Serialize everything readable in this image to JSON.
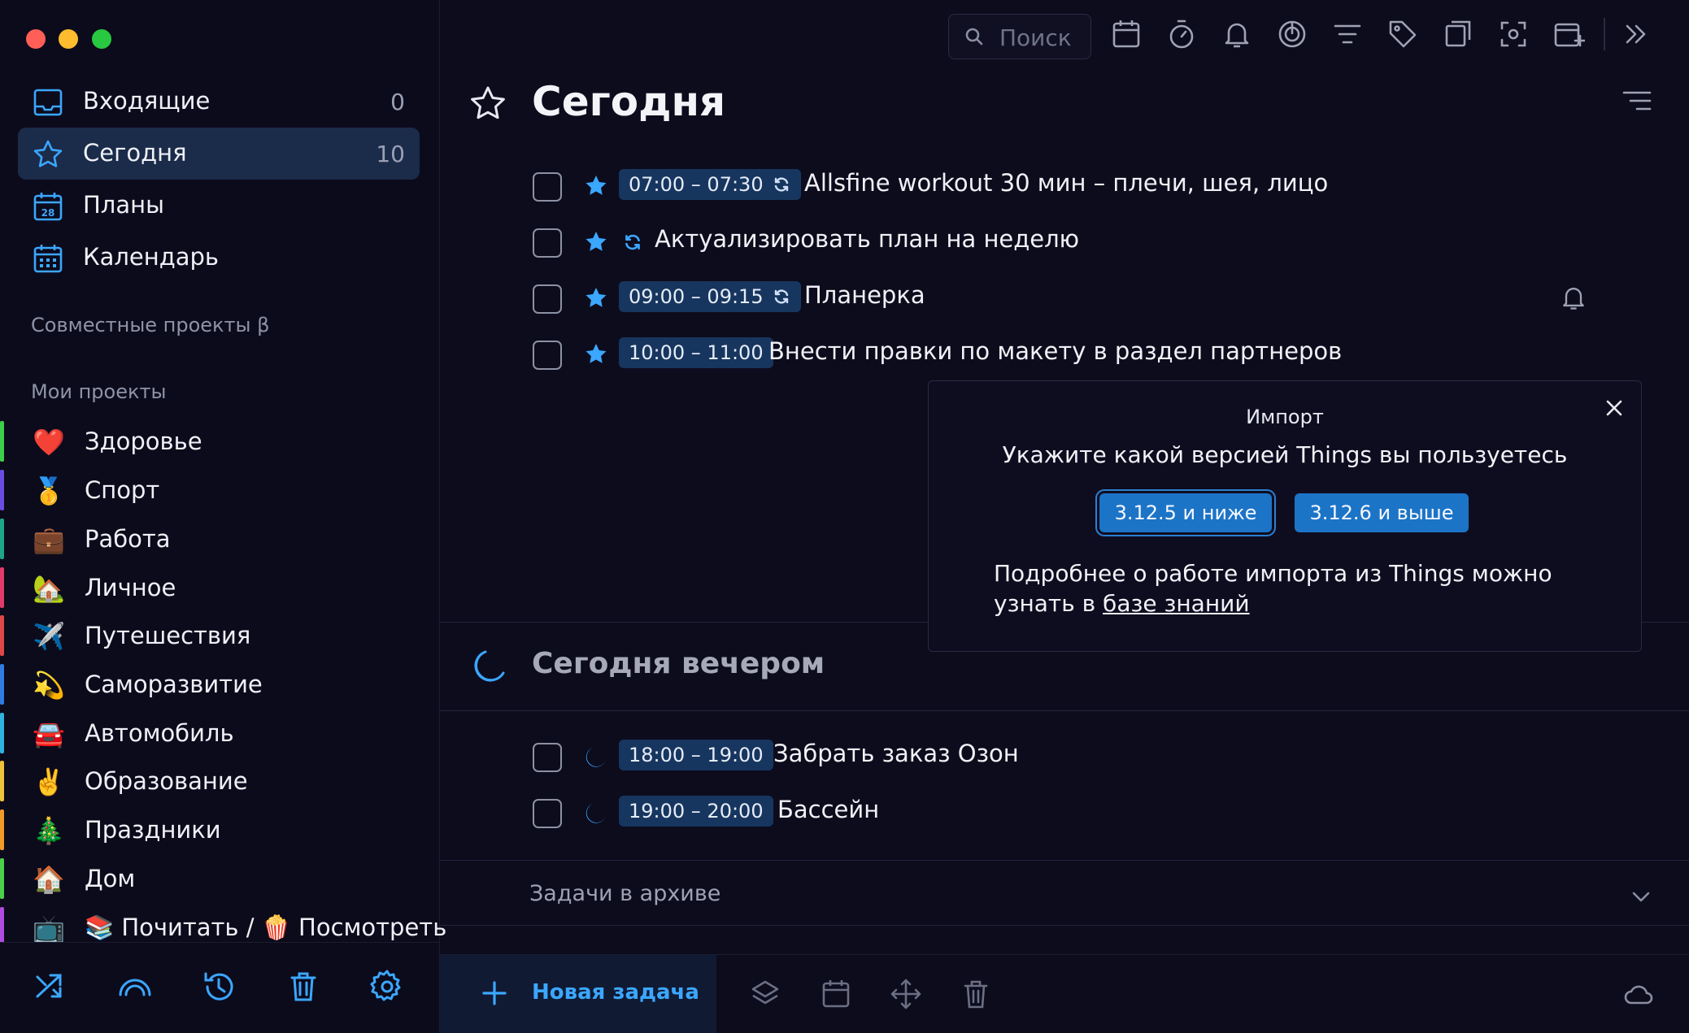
{
  "sidebar": {
    "nav": [
      {
        "label": "Входящие",
        "count": "0",
        "icon": "inbox-icon"
      },
      {
        "label": "Сегодня",
        "count": "10",
        "icon": "star-icon"
      },
      {
        "label": "Планы",
        "count": "",
        "icon": "calendar-28-icon"
      },
      {
        "label": "Календарь",
        "count": "",
        "icon": "calendar-grid-icon"
      }
    ],
    "shared_header": "Совместные проекты β",
    "projects_header": "Мои проекты",
    "projects": [
      {
        "label": "Здоровье",
        "emoji": "❤️",
        "color": "#3ecf4a"
      },
      {
        "label": "Спорт",
        "emoji": "🥇",
        "color": "#6a4de0"
      },
      {
        "label": "Работа",
        "emoji": "💼",
        "color": "#1fa58a"
      },
      {
        "label": "Личное",
        "emoji": "🏡",
        "color": "#e23a6a"
      },
      {
        "label": "Путешествия",
        "emoji": "✈️",
        "color": "#e04848"
      },
      {
        "label": "Саморазвитие",
        "emoji": "💫",
        "color": "#2f7de0"
      },
      {
        "label": "Автомобиль",
        "emoji": "🚘",
        "color": "#2fb3e0"
      },
      {
        "label": "Образование",
        "emoji": "✌️",
        "color": "#f0c23a"
      },
      {
        "label": "Праздники",
        "emoji": "🎄",
        "color": "#f09a2a"
      },
      {
        "label": "Дом",
        "emoji": "🏠",
        "color": "#4ad04a"
      },
      {
        "label": "📚 Почитать / 🍿 Посмотреть",
        "emoji": "📺",
        "color": "#b04ae0"
      }
    ],
    "bottom_icons": [
      "shuffle-icon",
      "rainbow-icon",
      "history-icon",
      "trash-icon",
      "settings-icon"
    ]
  },
  "toolbar": {
    "search_placeholder": "Поиск",
    "icons": [
      "calendar-icon",
      "timer-icon",
      "bell-icon",
      "focus-icon",
      "filter-icon",
      "tag-icon",
      "export-icon",
      "screenshot-icon",
      "add-window-icon",
      "collapse-icon"
    ]
  },
  "main": {
    "title": "Сегодня",
    "tasks": [
      {
        "time": "07:00 – 07:30",
        "repeat": true,
        "title": "Allsfine workout 30 мин – плечи, шея, лицо"
      },
      {
        "time": "",
        "repeat": true,
        "title": "Актуализировать план на неделю"
      },
      {
        "time": "09:00 – 09:15",
        "repeat": true,
        "title": "Планерка",
        "bell": true
      },
      {
        "time": "10:00 – 11:00",
        "repeat": false,
        "title": "Внести правки по макету в раздел партнеров"
      }
    ],
    "evening_title": "Сегодня вечером",
    "evening_tasks": [
      {
        "time": "18:00 – 19:00",
        "title": "Забрать заказ Озон"
      },
      {
        "time": "19:00 – 20:00",
        "title": "Бассейн"
      }
    ],
    "archive_label": "Задачи в архиве",
    "new_task_label": "Новая задача"
  },
  "modal": {
    "title": "Импорт",
    "question": "Укажите какой версией Things вы пользуетесь",
    "btn_low": "3.12.5 и ниже",
    "btn_high": "3.12.6 и выше",
    "more_text": "Подробнее о работе импорта из Things можно узнать в",
    "more_link": "базе знаний"
  },
  "colors": {
    "accent": "#3ba7ff",
    "chip": "#17365f",
    "active_nav": "#1b2b4a",
    "button": "#1c74c7"
  }
}
